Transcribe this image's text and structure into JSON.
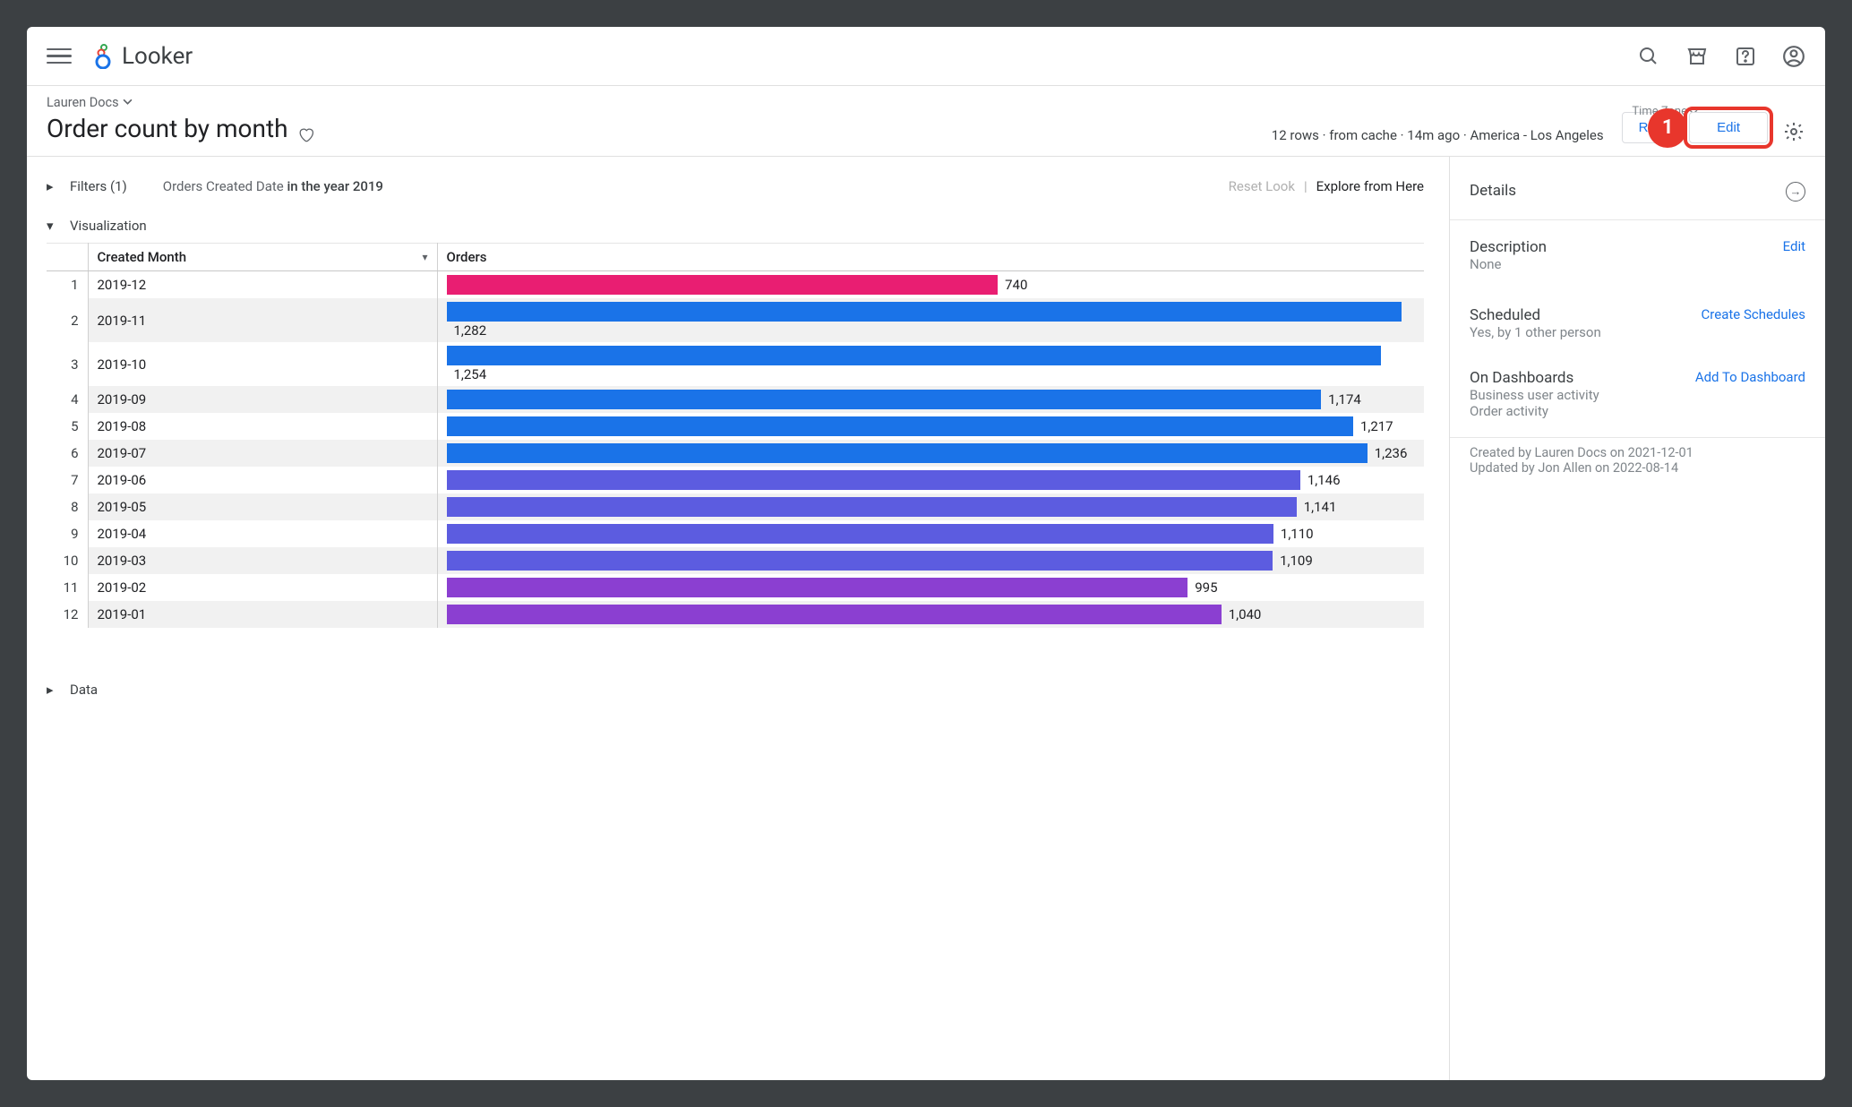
{
  "header": {
    "product": "Looker"
  },
  "breadcrumb": "Lauren Docs",
  "title": "Order count by month",
  "status_line": "12 rows · from cache · 14m ago · America - Los Angeles",
  "timezone_label": "Time Zone",
  "run_button": "Run",
  "edit_button": "Edit",
  "callout_number": "1",
  "filters": {
    "label": "Filters (1)",
    "text_prefix": "Orders Created Date ",
    "text_bold": "in the year 2019",
    "reset": "Reset Look",
    "explore": "Explore from Here"
  },
  "viz_label": "Visualization",
  "data_label": "Data",
  "columns": {
    "month": "Created Month",
    "orders": "Orders"
  },
  "chart_data": {
    "type": "bar",
    "orientation": "horizontal",
    "xlabel": "Orders",
    "ylabel": "Created Month",
    "categories": [
      "2019-12",
      "2019-11",
      "2019-10",
      "2019-09",
      "2019-08",
      "2019-07",
      "2019-06",
      "2019-05",
      "2019-04",
      "2019-03",
      "2019-02",
      "2019-01"
    ],
    "values": [
      740,
      1282,
      1254,
      1174,
      1217,
      1236,
      1146,
      1141,
      1110,
      1109,
      995,
      1040
    ],
    "value_labels": [
      "740",
      "1,282",
      "1,254",
      "1,174",
      "1,217",
      "1,236",
      "1,146",
      "1,141",
      "1,110",
      "1,109",
      "995",
      "1,040"
    ],
    "colors": [
      "#e91e72",
      "#1a73e8",
      "#1a73e8",
      "#1a73e8",
      "#1a73e8",
      "#1a73e8",
      "#5c5ce0",
      "#5c5ce0",
      "#5c5ce0",
      "#5c5ce0",
      "#8b3fd1",
      "#8b3fd1"
    ],
    "xlim": [
      0,
      1300
    ]
  },
  "details": {
    "heading": "Details",
    "description_label": "Description",
    "description_value": "None",
    "description_edit": "Edit",
    "scheduled_label": "Scheduled",
    "scheduled_value": "Yes, by 1 other person",
    "scheduled_link": "Create Schedules",
    "dash_label": "On Dashboards",
    "dash_value1": "Business user activity",
    "dash_value2": "Order activity",
    "dash_link": "Add To Dashboard",
    "created": "Created by Lauren Docs on 2021-12-01",
    "updated": "Updated by Jon Allen on 2022-08-14"
  }
}
